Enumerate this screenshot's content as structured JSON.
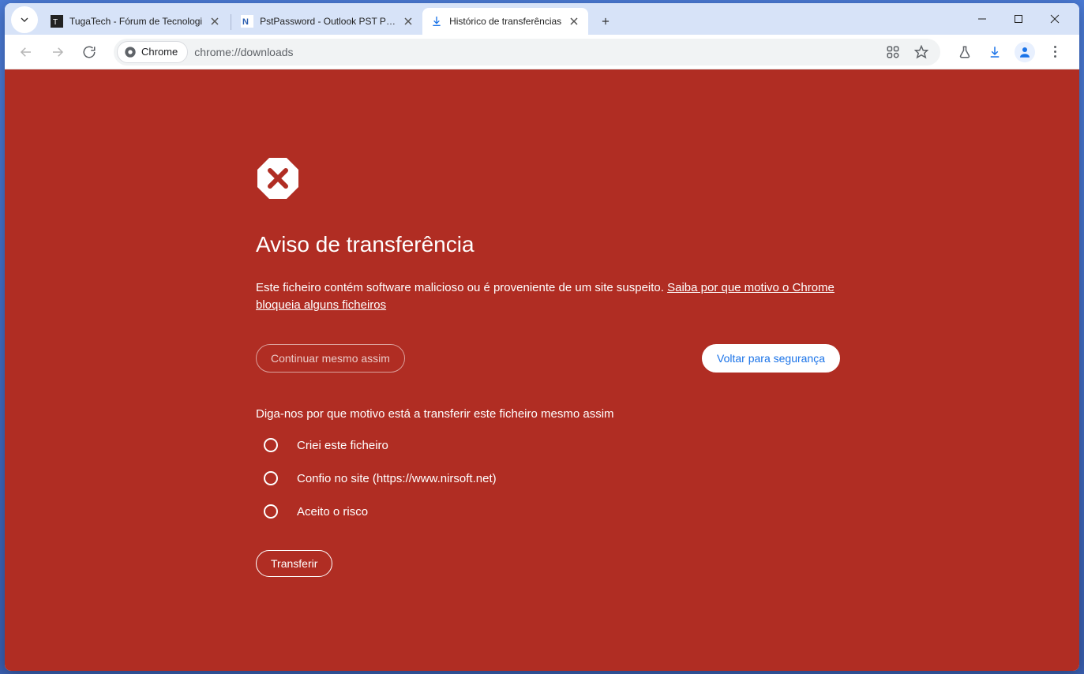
{
  "tabs": [
    {
      "title": "TugaTech - Fórum de Tecnologi"
    },
    {
      "title": "PstPassword - Outlook PST Pass"
    },
    {
      "title": "Histórico de transferências"
    }
  ],
  "omnibox": {
    "chip_label": "Chrome",
    "url": "chrome://downloads"
  },
  "warning": {
    "heading": "Aviso de transferência",
    "desc_text": "Este ficheiro contém software malicioso ou é proveniente de um site suspeito. ",
    "desc_link": "Saiba por que motivo o Chrome bloqueia alguns ficheiros",
    "btn_continue": "Continuar mesmo assim",
    "btn_back": "Voltar para segurança",
    "survey_q": "Diga-nos por que motivo está a transferir este ficheiro mesmo assim",
    "options": [
      "Criei este ficheiro",
      "Confio no site (https://www.nirsoft.net)",
      "Aceito o risco"
    ],
    "btn_transfer": "Transferir"
  }
}
